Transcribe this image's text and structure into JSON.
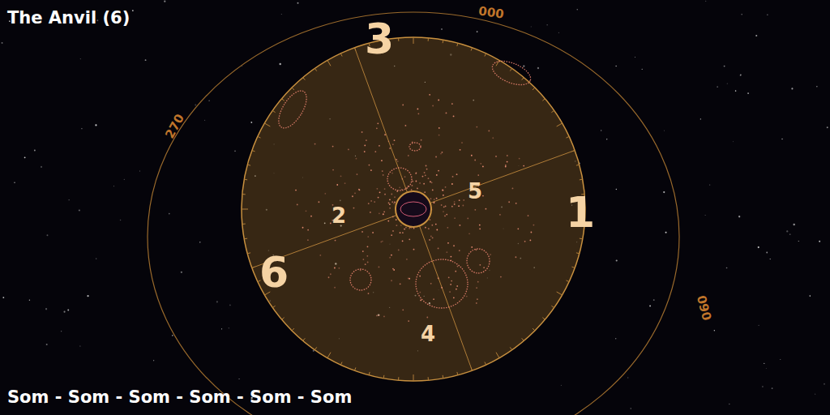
{
  "title": "The Anvil (6)",
  "footer": "Som - Som - Som - Som - Som - Som",
  "bearings": [
    {
      "label": "000"
    },
    {
      "label": "270"
    },
    {
      "label": "090"
    }
  ],
  "bodies": [
    {
      "label": "3",
      "kind": "major"
    },
    {
      "label": "1",
      "kind": "major"
    },
    {
      "label": "6",
      "kind": "major"
    },
    {
      "label": "2",
      "kind": "minor"
    },
    {
      "label": "5",
      "kind": "minor"
    },
    {
      "label": "4",
      "kind": "minor"
    }
  ]
}
